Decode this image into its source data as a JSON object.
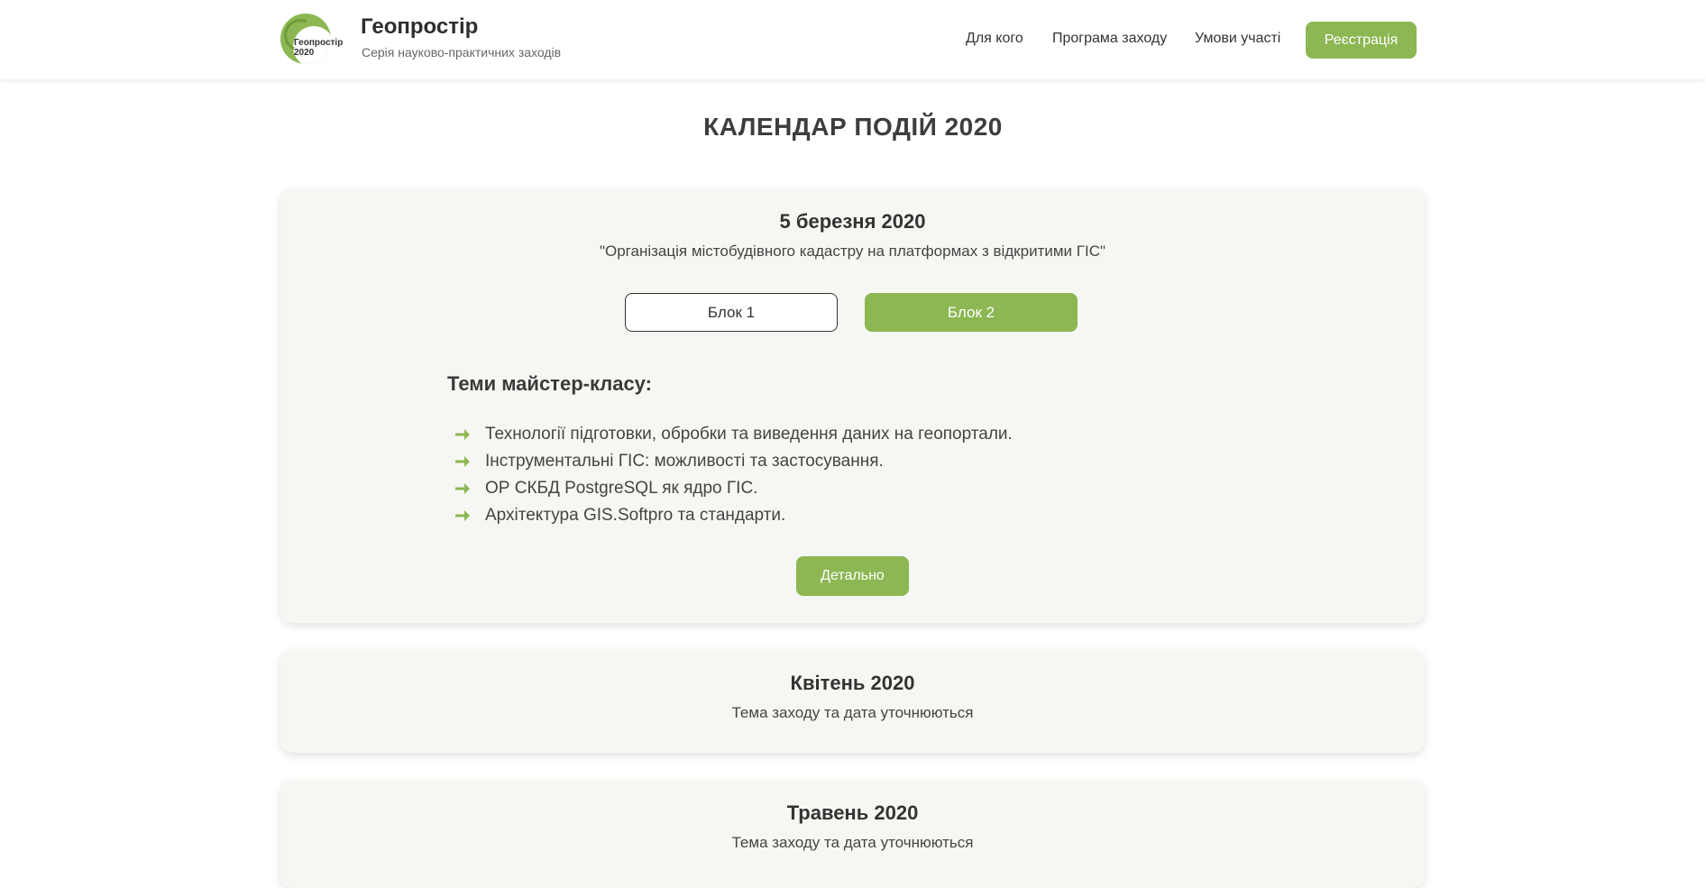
{
  "header": {
    "logo_text": "Геопростір 2020",
    "brand_title": "Геопростір",
    "brand_subtitle": "Серія науково-практичних заходів",
    "nav": [
      "Для кого",
      "Програма заходу",
      "Умови участі"
    ],
    "register_label": "Реєстрація"
  },
  "page_title": "КАЛЕНДАР ПОДІЙ 2020",
  "events": [
    {
      "date": "5 березня 2020",
      "subtitle": "\"Організація містобудівного кадастру на платформах з відкритими ГІС\"",
      "tabs": [
        "Блок 1",
        "Блок 2"
      ],
      "active_tab": "Блок 2",
      "topics_heading": "Теми майстер-класу:",
      "topics": [
        "Технології підготовки, обробки та виведення даних на геопортали.",
        "Інструментальні ГІС: можливості та застосування.",
        "ОР СКБД PostgreSQL як ядро ГІС.",
        "Архітектура GIS.Softpro та стандарти."
      ],
      "detail_label": "Детально"
    },
    {
      "date": "Квітень 2020",
      "subtitle": "Тема заходу та дата уточнюються"
    },
    {
      "date": "Травень 2020",
      "subtitle": "Тема заходу та дата уточнюються"
    }
  ],
  "colors": {
    "accent": "#8cb752",
    "card_bg": "#f6f7f2",
    "text": "#3f3f3f"
  }
}
